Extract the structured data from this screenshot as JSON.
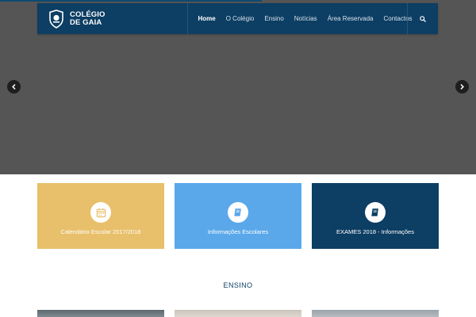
{
  "brand": {
    "line1": "COLÉGIO",
    "line2": "DE GAIA",
    "logo_icon": "school-crest-icon"
  },
  "nav": {
    "items": [
      {
        "label": "Home",
        "active": true
      },
      {
        "label": "O Colégio",
        "active": false
      },
      {
        "label": "Ensino",
        "active": false
      },
      {
        "label": "Notícias",
        "active": false
      },
      {
        "label": "Área Reservada",
        "active": false
      },
      {
        "label": "Contactos",
        "active": false
      }
    ],
    "search_icon": "search-icon"
  },
  "slider": {
    "prev_icon": "chevron-left-icon",
    "next_icon": "chevron-right-icon",
    "progress_fraction": 0.55
  },
  "tiles": [
    {
      "label": "Calendário Escolar 2017/2018",
      "icon": "calendar-icon",
      "color": "#e8bf6a",
      "icon_color": "#e8bf6a"
    },
    {
      "label": "Informações Escolares",
      "icon": "book-icon",
      "color": "#5aa8ea",
      "icon_color": "#5aa8ea"
    },
    {
      "label": "EXAMES 2018 - Informações",
      "icon": "book-icon",
      "color": "#0d3e63",
      "icon_color": "#0d3e63"
    }
  ],
  "section": {
    "title": "ENSINO"
  },
  "colors": {
    "brand_navy": "#0d3e63",
    "hero_gray": "#555555"
  }
}
